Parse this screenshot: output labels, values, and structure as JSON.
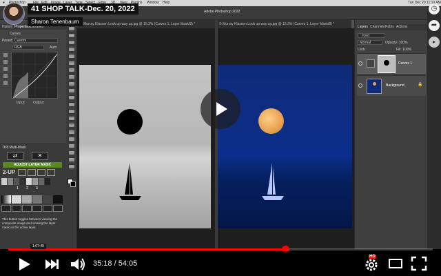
{
  "video": {
    "title": "41 SHOP TALK-Dec. 20, 2022",
    "channel": "Sharon Tenenbaum",
    "current_time": "35:18",
    "duration": "54:05",
    "time_separator": " / ",
    "hover_time": "1:07:49",
    "progress_fraction": 0.653,
    "hover_fraction": 0.07,
    "accent": "#ff0000",
    "badge": "HD"
  },
  "mac": {
    "menu": [
      "Photoshop",
      "File",
      "Edit",
      "Image",
      "Layer",
      "Type",
      "Select",
      "Filter",
      "3D",
      "View",
      "Plugins",
      "Window",
      "Help"
    ],
    "window_title": "Adobe Photoshop 2022",
    "clock": "Tue Dec 20 11:10 AM"
  },
  "photoshop": {
    "panel_tabs": [
      "History",
      "Properties",
      "Libraries"
    ],
    "properties_title": "Curves",
    "preset_label": "Preset:",
    "preset_value": "Custom",
    "channel_value": "RGB",
    "auto_label": "Auto",
    "input_label": "Input:",
    "output_label": "Output:",
    "doc_tab_left": "© Murray Klassen Look up way up.jpg @ 15.3% (Curves 1, Layer Mask/8) *",
    "doc_tab_right": "© Murray Klassen Look up way up.jpg @ 15.3% (Curves 1, Layer Mask/8) *",
    "tkmask_title": "TK8 Multi-Mask",
    "adjust_label": "ADJUST LAYER MASK",
    "twoup_label": "2-UP",
    "num_labels": [
      "1",
      "2",
      "3"
    ],
    "help_text": "This button toggles between viewing the composite image and viewing the layer mask on the active layer.",
    "layers_tabs": [
      "Layers",
      "Channels",
      "Paths",
      "Actions"
    ],
    "kind_label": "Kind",
    "blend_mode": "Normal",
    "opacity_label": "Opacity: 100%",
    "fill_label": "Fill: 100%",
    "lock_label": "Lock:",
    "layers": [
      {
        "name": "Curves 1"
      },
      {
        "name": "Background"
      }
    ]
  },
  "icons": [
    "play-icon",
    "next-icon",
    "volume-icon",
    "settings-icon",
    "theater-icon",
    "fullscreen-icon",
    "clock-icon",
    "share-icon"
  ]
}
